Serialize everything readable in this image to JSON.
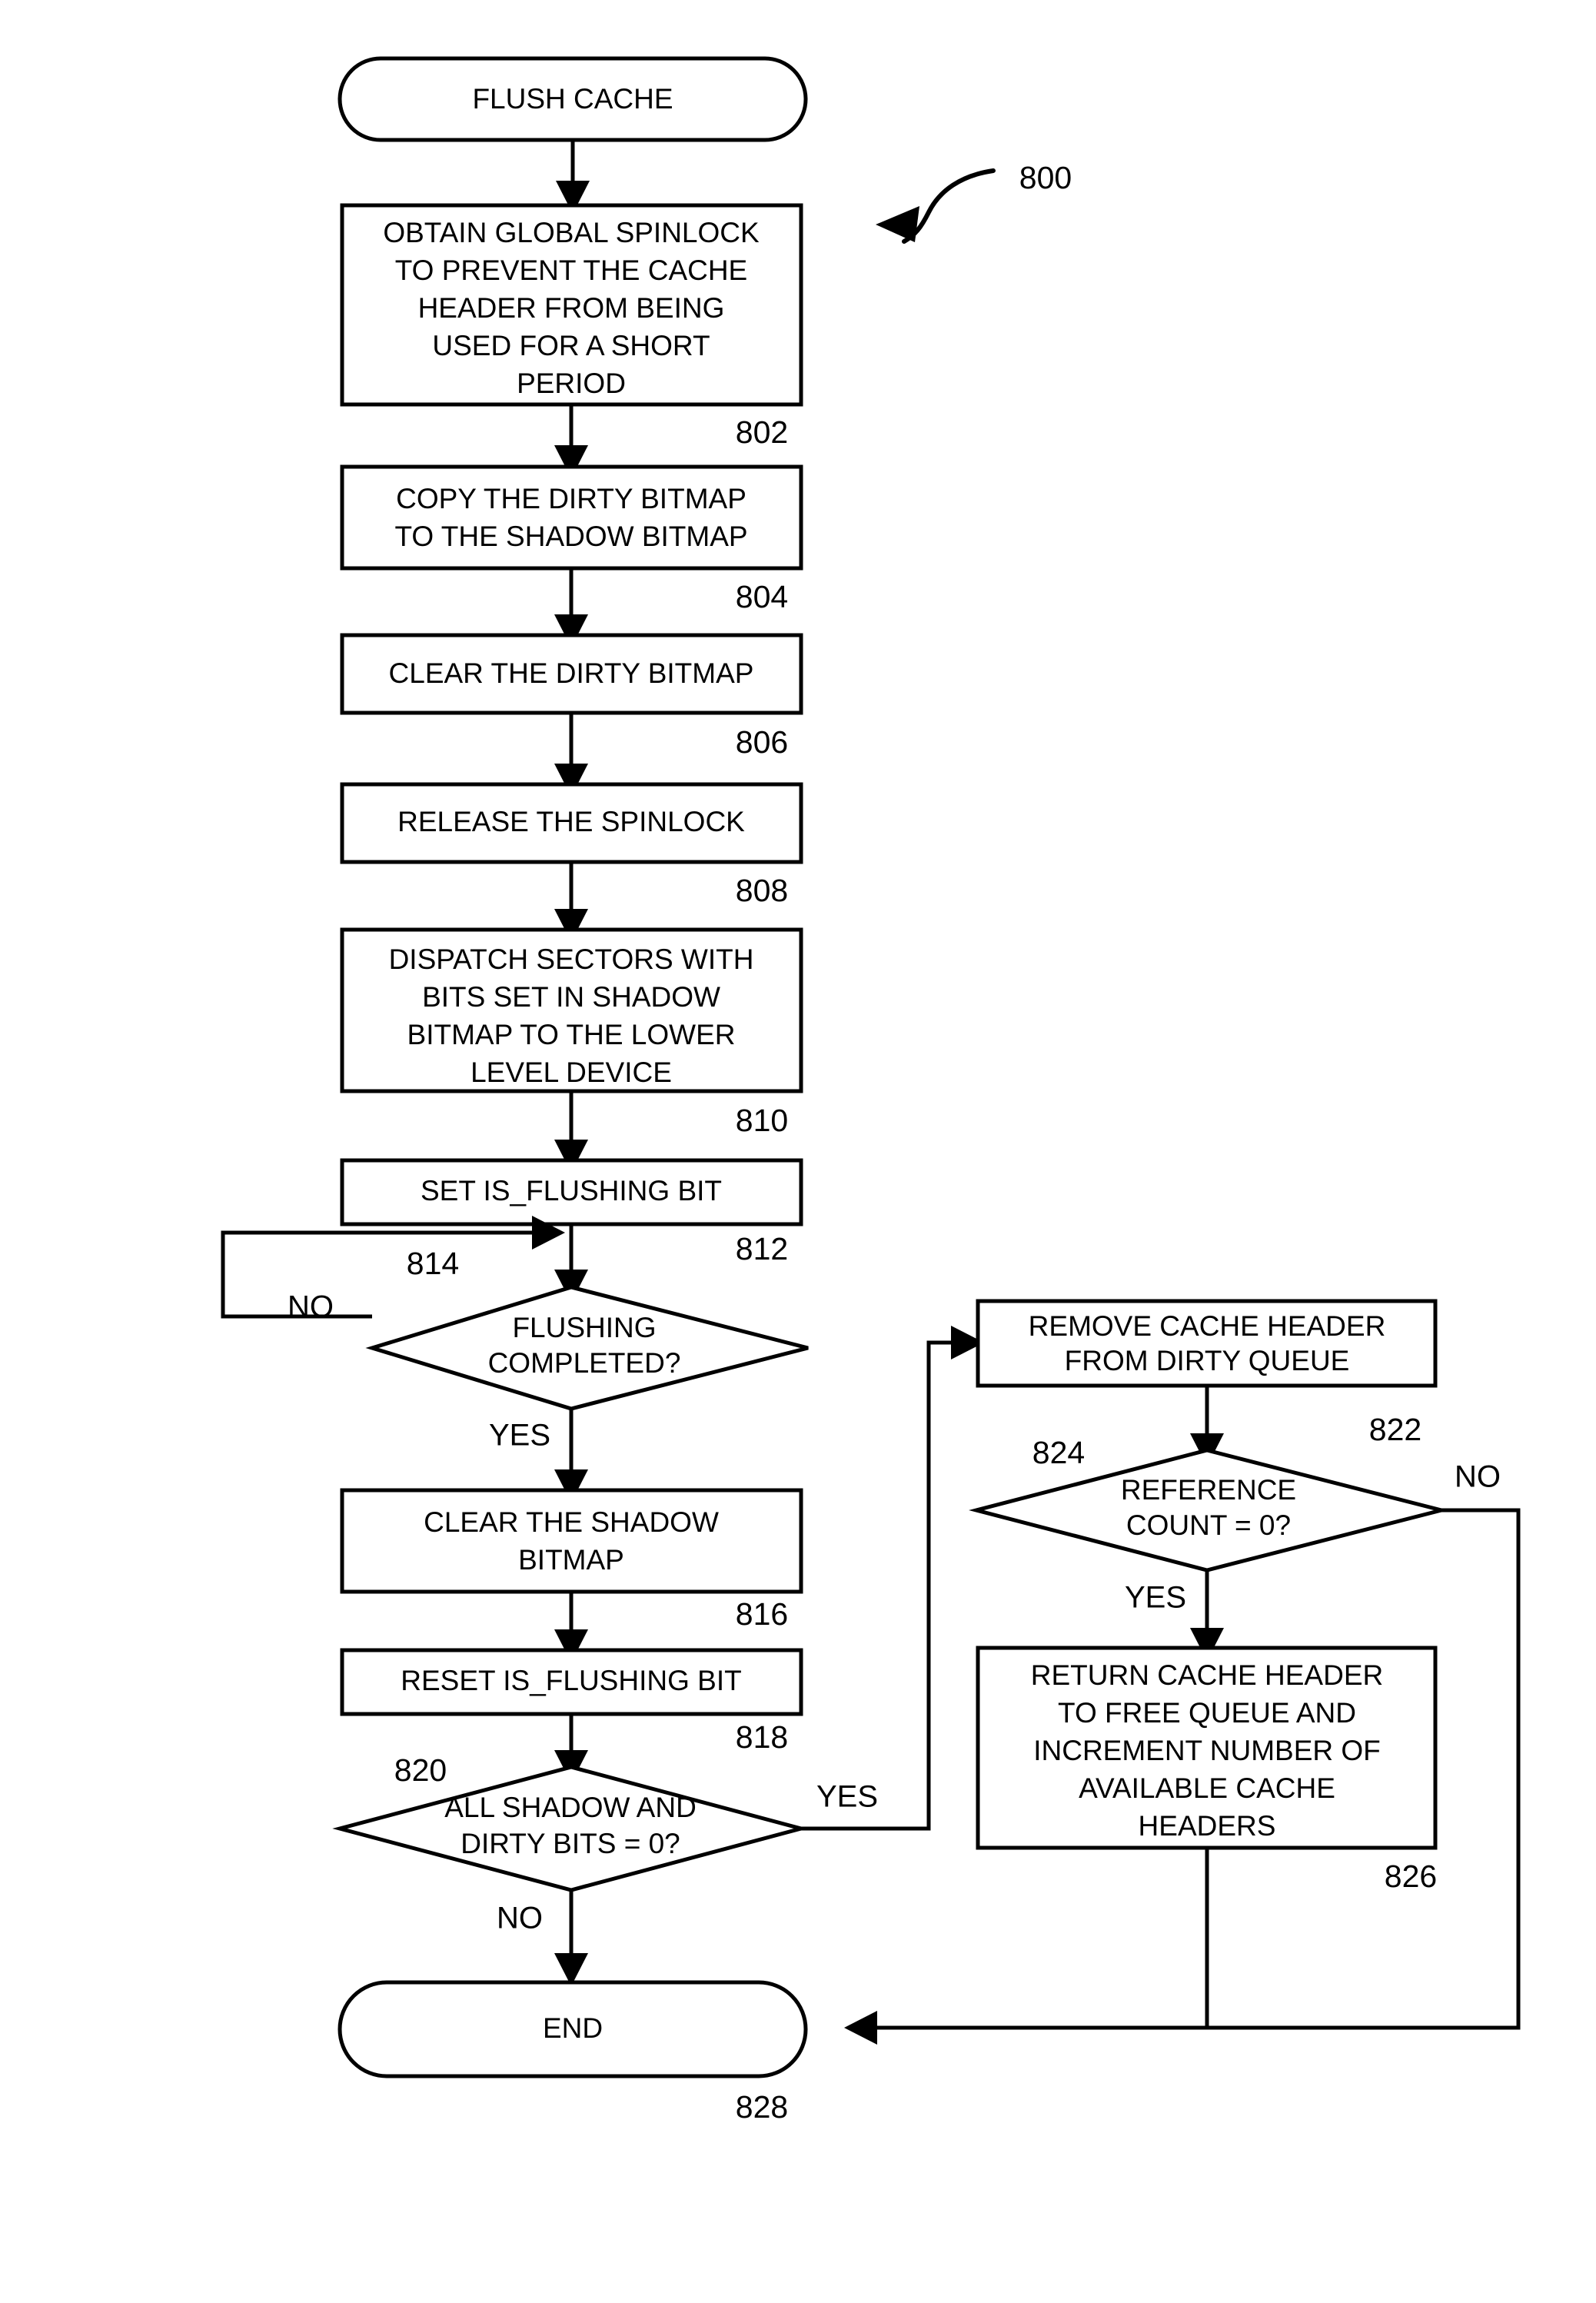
{
  "figure": {
    "label": "800",
    "type": "flowchart"
  },
  "nodes": {
    "start": {
      "ref": "",
      "shape": "terminator",
      "lines": [
        "FLUSH CACHE"
      ]
    },
    "n802": {
      "ref": "802",
      "shape": "process",
      "lines": [
        "OBTAIN GLOBAL SPINLOCK",
        "TO PREVENT THE CACHE",
        "HEADER FROM BEING",
        "USED FOR A SHORT",
        "PERIOD"
      ]
    },
    "n804": {
      "ref": "804",
      "shape": "process",
      "lines": [
        "COPY THE DIRTY BITMAP",
        "TO THE SHADOW BITMAP"
      ]
    },
    "n806": {
      "ref": "806",
      "shape": "process",
      "lines": [
        "CLEAR THE DIRTY BITMAP"
      ]
    },
    "n808": {
      "ref": "808",
      "shape": "process",
      "lines": [
        "RELEASE THE SPINLOCK"
      ]
    },
    "n810": {
      "ref": "810",
      "shape": "process",
      "lines": [
        "DISPATCH SECTORS WITH",
        "BITS SET IN SHADOW",
        "BITMAP TO THE LOWER",
        "LEVEL DEVICE"
      ]
    },
    "n812": {
      "ref": "812",
      "shape": "process",
      "lines": [
        "SET IS_FLUSHING BIT"
      ]
    },
    "n814": {
      "ref": "814",
      "shape": "decision",
      "lines": [
        "FLUSHING",
        "COMPLETED?"
      ],
      "yes": "YES",
      "no": "NO"
    },
    "n816": {
      "ref": "816",
      "shape": "process",
      "lines": [
        "CLEAR THE SHADOW",
        "BITMAP"
      ]
    },
    "n818": {
      "ref": "818",
      "shape": "process",
      "lines": [
        "RESET IS_FLUSHING BIT"
      ]
    },
    "n820": {
      "ref": "820",
      "shape": "decision",
      "lines": [
        "ALL SHADOW AND",
        "DIRTY BITS = 0?"
      ],
      "yes": "YES",
      "no": "NO"
    },
    "n822": {
      "ref": "822",
      "shape": "process",
      "lines": [
        "REMOVE CACHE HEADER",
        "FROM DIRTY QUEUE"
      ]
    },
    "n824": {
      "ref": "824",
      "shape": "decision",
      "lines": [
        "REFERENCE",
        "COUNT = 0?"
      ],
      "yes": "YES",
      "no": "NO"
    },
    "n826": {
      "ref": "826",
      "shape": "process",
      "lines": [
        "RETURN CACHE HEADER",
        "TO FREE QUEUE AND",
        "INCREMENT NUMBER OF",
        "AVAILABLE CACHE",
        "HEADERS"
      ]
    },
    "n828": {
      "ref": "828",
      "shape": "terminator",
      "lines": [
        "END"
      ]
    }
  },
  "colors": {
    "stroke": "#000000",
    "fill": "#ffffff",
    "text": "#000000"
  }
}
